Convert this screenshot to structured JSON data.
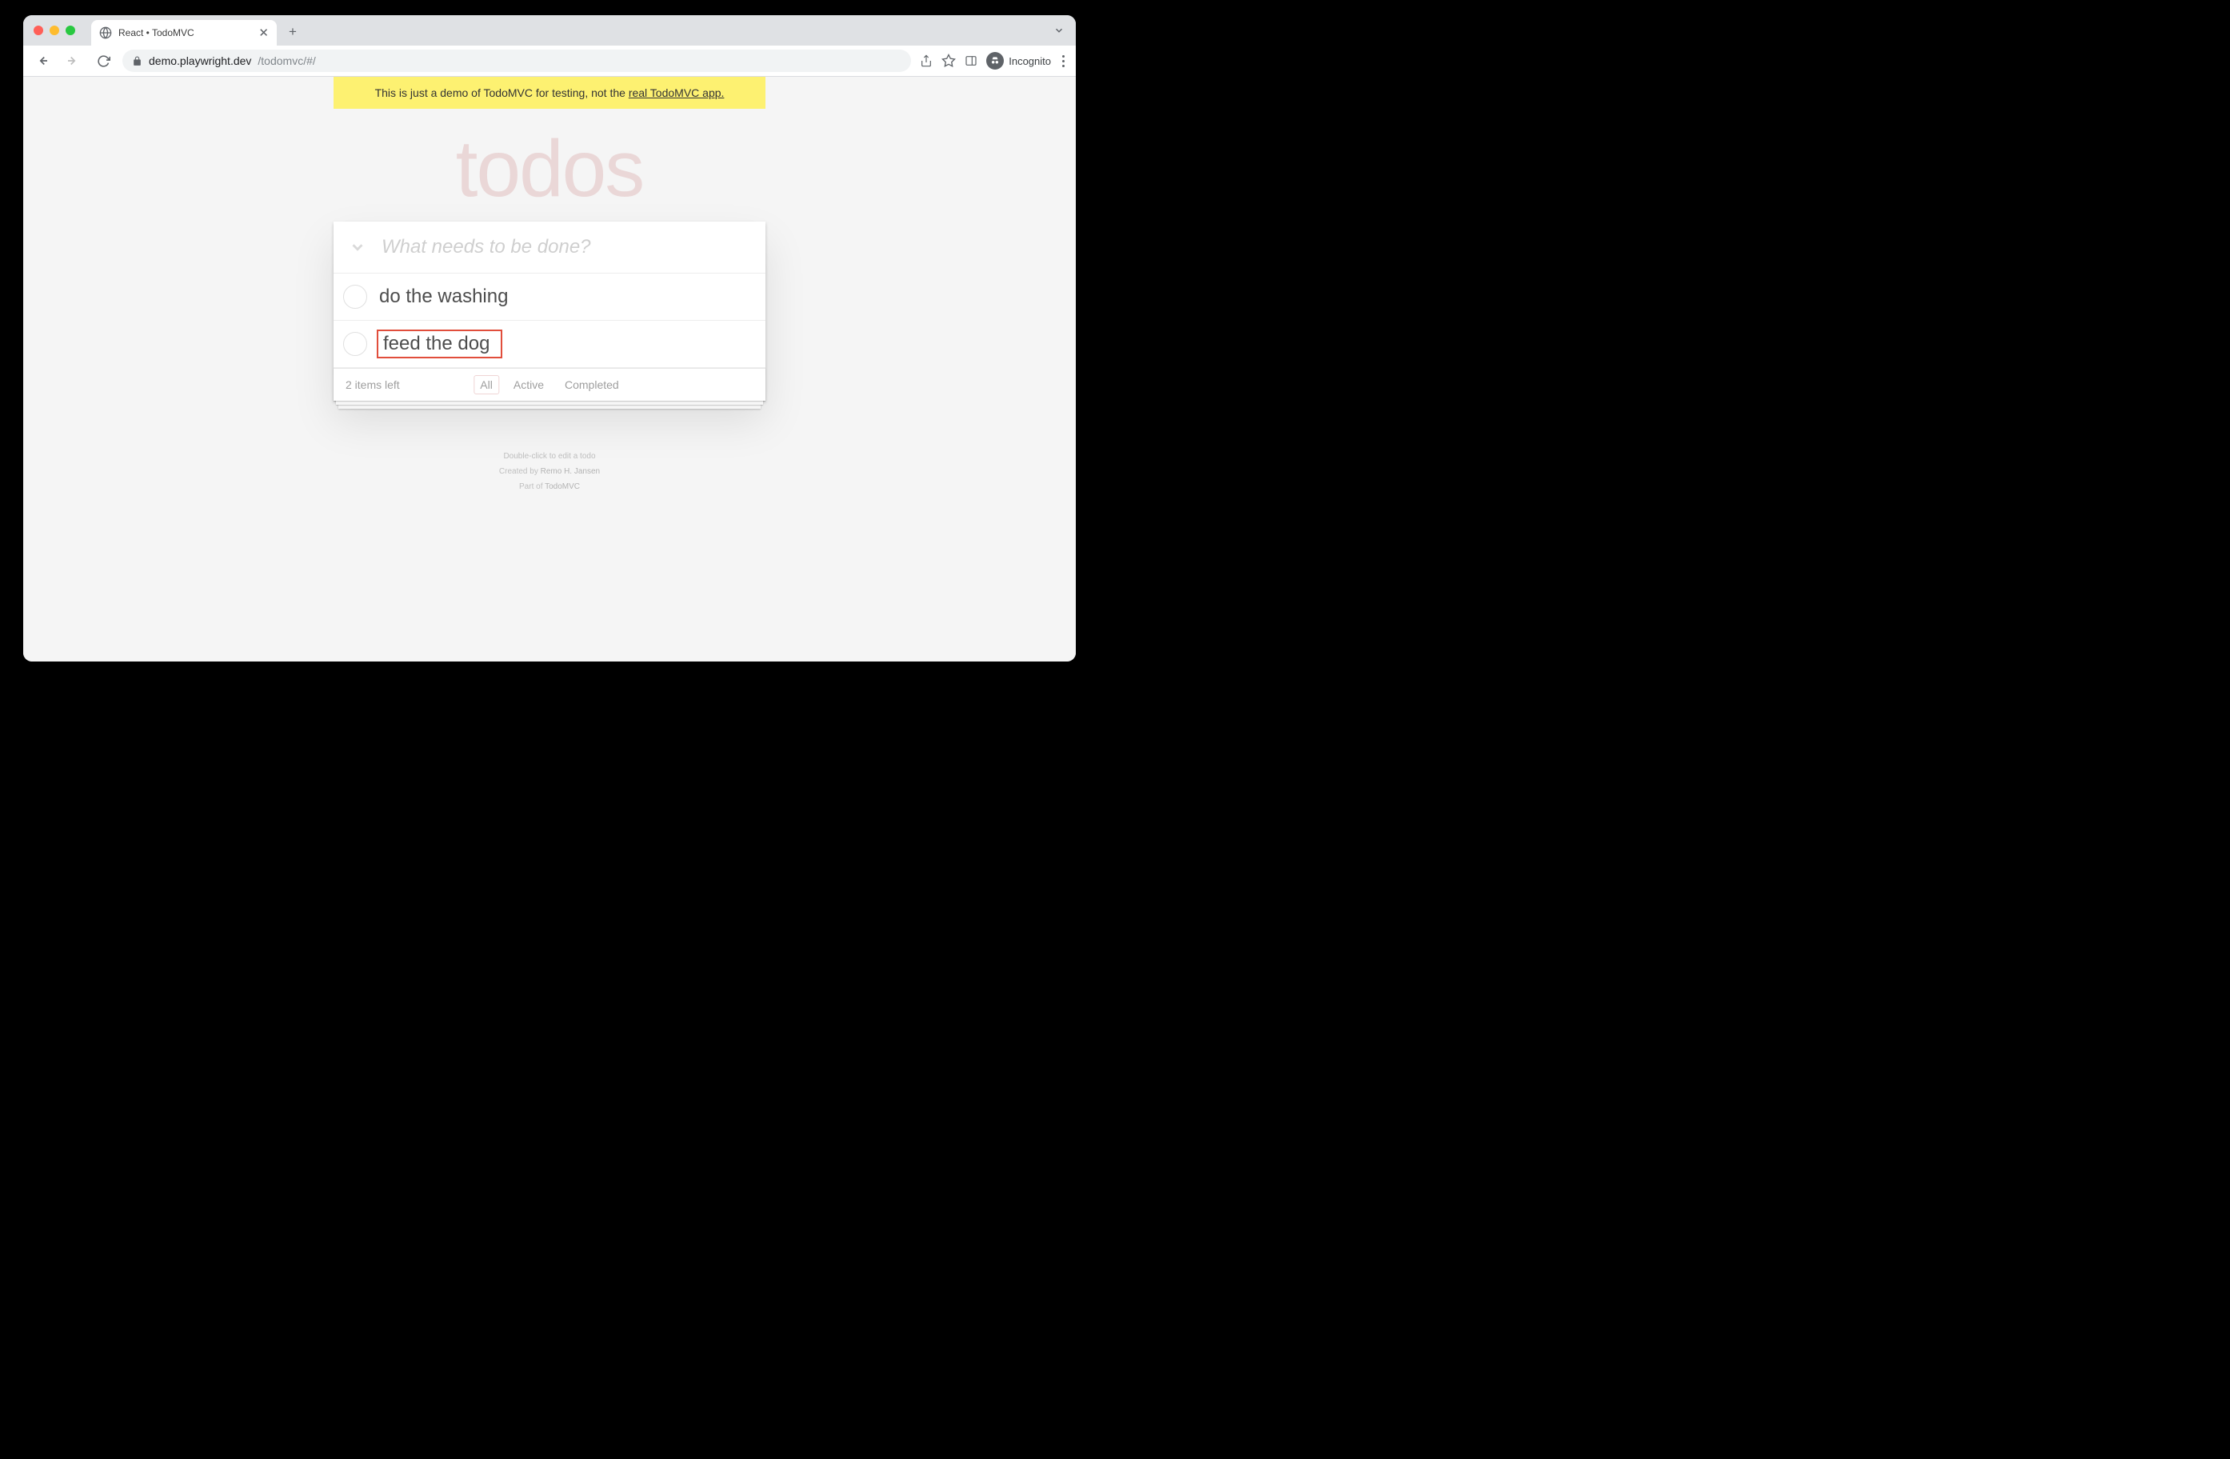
{
  "browser": {
    "tab_title": "React • TodoMVC",
    "url_host": "demo.playwright.dev",
    "url_path": "/todomvc/#/",
    "incognito_label": "Incognito"
  },
  "banner": {
    "text_prefix": "This is just a demo of TodoMVC for testing, not the ",
    "link_text": "real TodoMVC app."
  },
  "app": {
    "title": "todos",
    "new_todo_placeholder": "What needs to be done?",
    "items": [
      {
        "label": "do the washing",
        "completed": false,
        "highlighted": false
      },
      {
        "label": "feed the dog",
        "completed": false,
        "highlighted": true
      }
    ],
    "items_left_text": "2 items left",
    "filters": {
      "all": "All",
      "active": "Active",
      "completed": "Completed",
      "selected": "all"
    }
  },
  "info": {
    "line1": "Double-click to edit a todo",
    "line2_prefix": "Created by ",
    "line2_link": "Remo H. Jansen",
    "line3_prefix": "Part of ",
    "line3_link": "TodoMVC"
  }
}
